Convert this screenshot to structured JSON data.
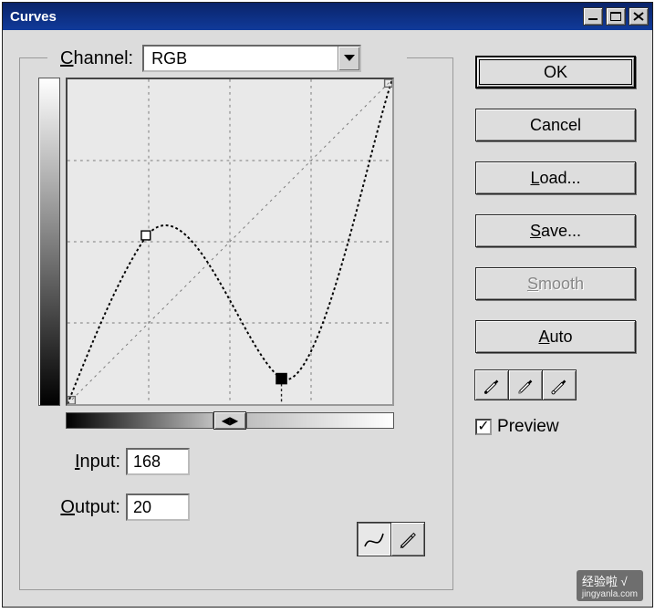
{
  "window": {
    "title": "Curves"
  },
  "channel": {
    "label_prefix": "C",
    "label_rest": "hannel:",
    "value": "RGB"
  },
  "chart_data": {
    "type": "line",
    "title": "Curves",
    "xlabel": "Input",
    "ylabel": "Output",
    "xlim": [
      0,
      255
    ],
    "ylim": [
      0,
      255
    ],
    "grid": true,
    "points": [
      {
        "input": 0,
        "output": 0
      },
      {
        "input": 62,
        "output": 132
      },
      {
        "input": 168,
        "output": 20
      },
      {
        "input": 255,
        "output": 255
      }
    ],
    "selected_point_index": 2
  },
  "input": {
    "label_prefix": "I",
    "label_rest": "nput:",
    "value": "168"
  },
  "output": {
    "label_prefix": "O",
    "label_rest": "utput:",
    "value": "20"
  },
  "tools": {
    "curve_tool": "∿",
    "pencil_tool": "✎",
    "grad_split": "◀▶"
  },
  "buttons": {
    "ok": "OK",
    "cancel": "Cancel",
    "load_prefix": "L",
    "load_rest": "oad...",
    "save_prefix": "S",
    "save_rest": "ave...",
    "smooth_prefix": "S",
    "smooth_rest": "mooth",
    "auto_prefix": "A",
    "auto_rest": "uto"
  },
  "preview": {
    "checked": "✓",
    "label_prefix": "P",
    "label_rest": "review"
  },
  "watermark": {
    "text": "经验啦 √",
    "url": "jingyanla.com"
  }
}
